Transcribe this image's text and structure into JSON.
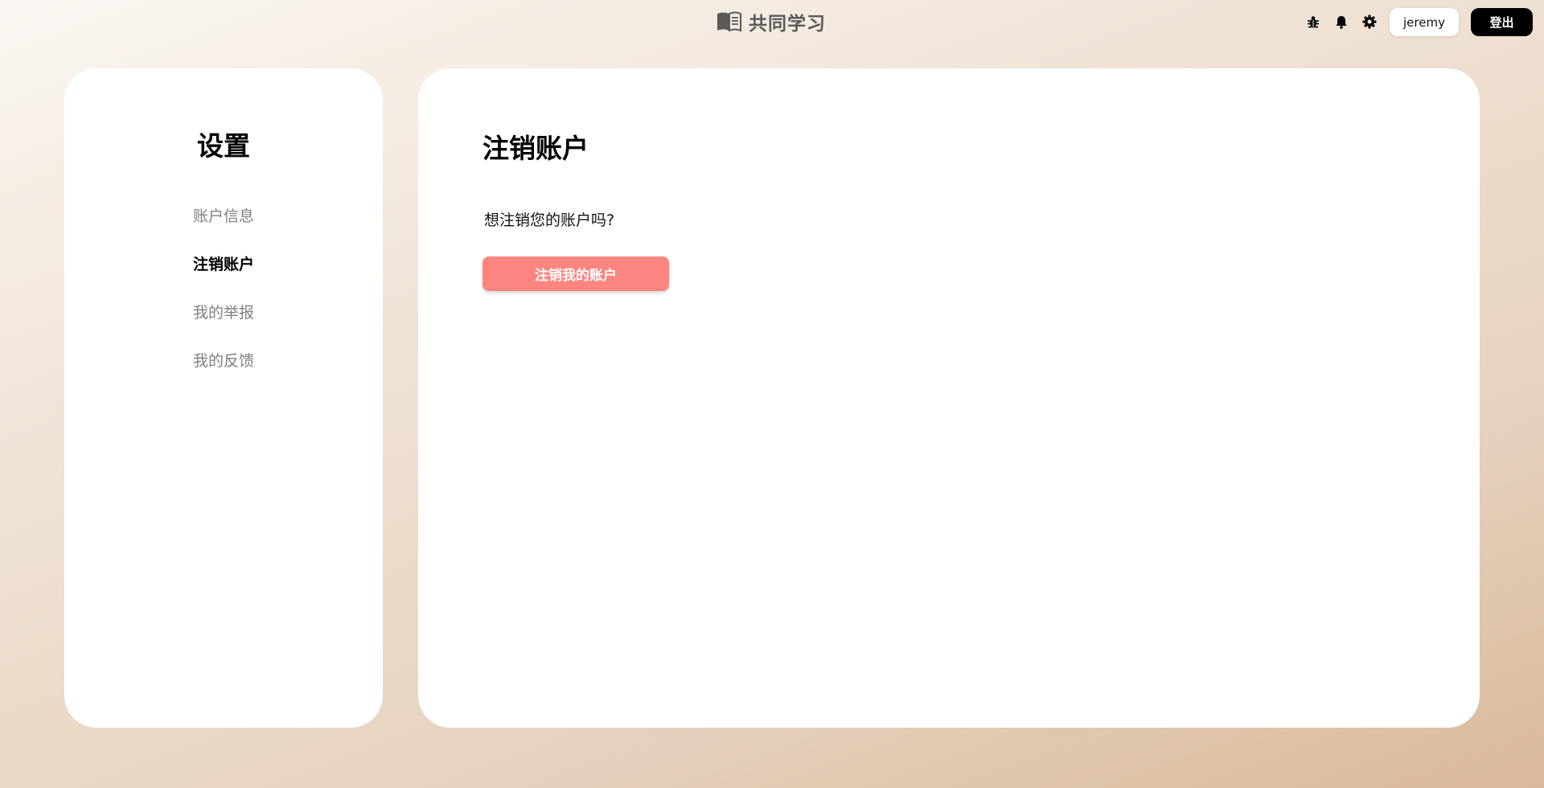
{
  "header": {
    "brand_icon": "open-book-icon",
    "brand_name": "共同学习",
    "icons": [
      "bug-icon",
      "bell-icon",
      "gear-icon"
    ],
    "username": "jeremy",
    "logout_label": "登出"
  },
  "sidebar": {
    "title": "设置",
    "items": [
      {
        "label": "账户信息",
        "active": false
      },
      {
        "label": "注销账户",
        "active": true
      },
      {
        "label": "我的举报",
        "active": false
      },
      {
        "label": "我的反馈",
        "active": false
      }
    ]
  },
  "main": {
    "title": "注销账户",
    "question": "想注销您的账户吗?",
    "delete_button_label": "注销我的账户"
  },
  "colors": {
    "danger": "#fd8580",
    "logout_bg": "#000000",
    "inactive_nav": "#808080"
  }
}
